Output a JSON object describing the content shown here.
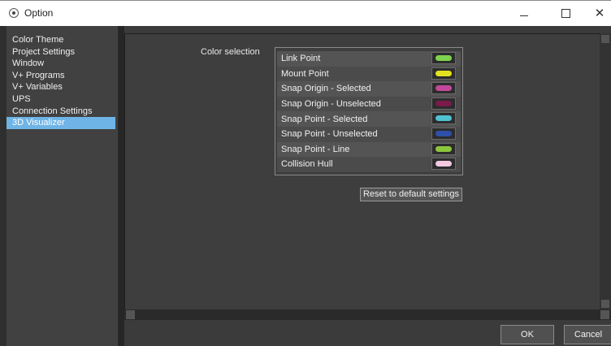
{
  "window": {
    "title": "Option",
    "controls": [
      "minimize-icon",
      "maximize-icon",
      "close-icon"
    ]
  },
  "sidebar": {
    "items": [
      {
        "label": "Color Theme",
        "selected": false
      },
      {
        "label": "Project Settings",
        "selected": false
      },
      {
        "label": "Window",
        "selected": false
      },
      {
        "label": "V+ Programs",
        "selected": false
      },
      {
        "label": "V+ Variables",
        "selected": false
      },
      {
        "label": "UPS",
        "selected": false
      },
      {
        "label": "Connection Settings",
        "selected": false
      },
      {
        "label": "3D Visualizer",
        "selected": true
      }
    ]
  },
  "main": {
    "section_label": "Color selection",
    "colors": [
      {
        "label": "Link Point",
        "color": "#7fd34f"
      },
      {
        "label": "Mount Point",
        "color": "#e3e21f"
      },
      {
        "label": "Snap Origin - Selected",
        "color": "#c2489b"
      },
      {
        "label": "Snap Origin - Unselected",
        "color": "#7a1a4a"
      },
      {
        "label": "Snap Point - Selected",
        "color": "#4fc1d1"
      },
      {
        "label": "Snap Point - Unselected",
        "color": "#2f4fa8"
      },
      {
        "label": "Snap Point - Line",
        "color": "#8cc63f"
      },
      {
        "label": "Collision Hull",
        "color": "#f2c9e0"
      }
    ],
    "reset_label": "Reset to default settings"
  },
  "footer": {
    "ok_label": "OK",
    "cancel_label": "Cancel"
  },
  "theme": {
    "selected_color": "#6fb4e6",
    "background": "#3e3e3e"
  }
}
